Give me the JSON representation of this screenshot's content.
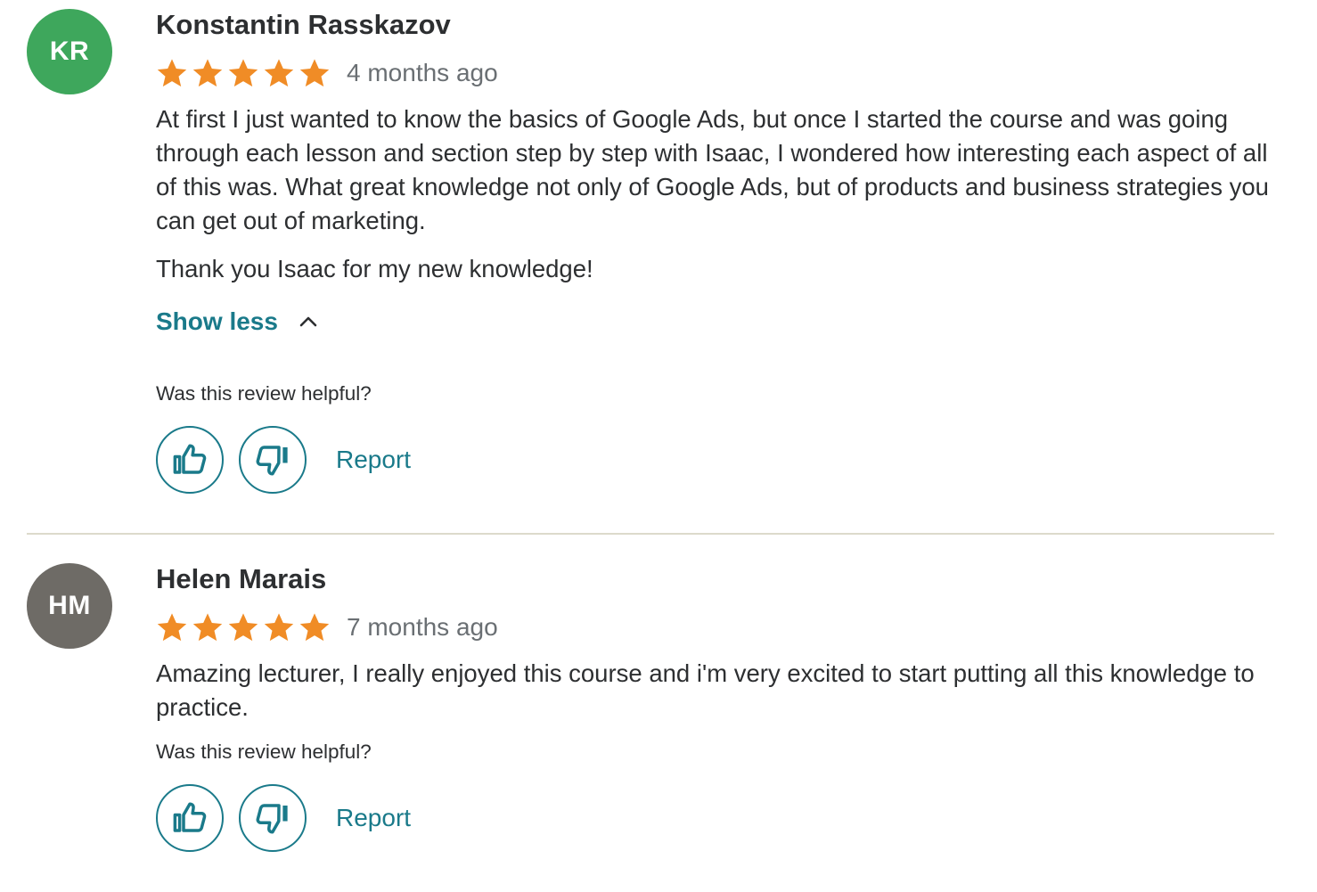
{
  "colors": {
    "star": "#f08c26",
    "accent": "#1a7a8a",
    "avatar_kr": "#3ea75c",
    "avatar_hm": "#6e6b66"
  },
  "reviews": [
    {
      "initials": "KR",
      "name": "Konstantin Rasskazov",
      "rating": 5,
      "time": "4 months ago",
      "paragraphs": [
        "At first I just wanted to know the basics of Google Ads, but once I started the course and was going through each lesson and section step by step with Isaac, I wondered how interesting each aspect of all of this was. What great knowledge not only of Google Ads, but of products and business strategies you can get out of marketing.",
        "Thank you Isaac for my new knowledge!"
      ],
      "show_less": "Show less",
      "helpful_question": "Was this review helpful?",
      "report_label": "Report"
    },
    {
      "initials": "HM",
      "name": "Helen Marais",
      "rating": 5,
      "time": "7 months ago",
      "paragraphs": [
        "Amazing lecturer, I really enjoyed this course and i'm very excited to start putting all this knowledge to practice."
      ],
      "helpful_question": "Was this review helpful?",
      "report_label": "Report"
    }
  ],
  "icons": {
    "star": "star-icon",
    "thumbs_up": "thumbs-up-icon",
    "thumbs_down": "thumbs-down-icon",
    "chevron_up": "chevron-up-icon"
  }
}
